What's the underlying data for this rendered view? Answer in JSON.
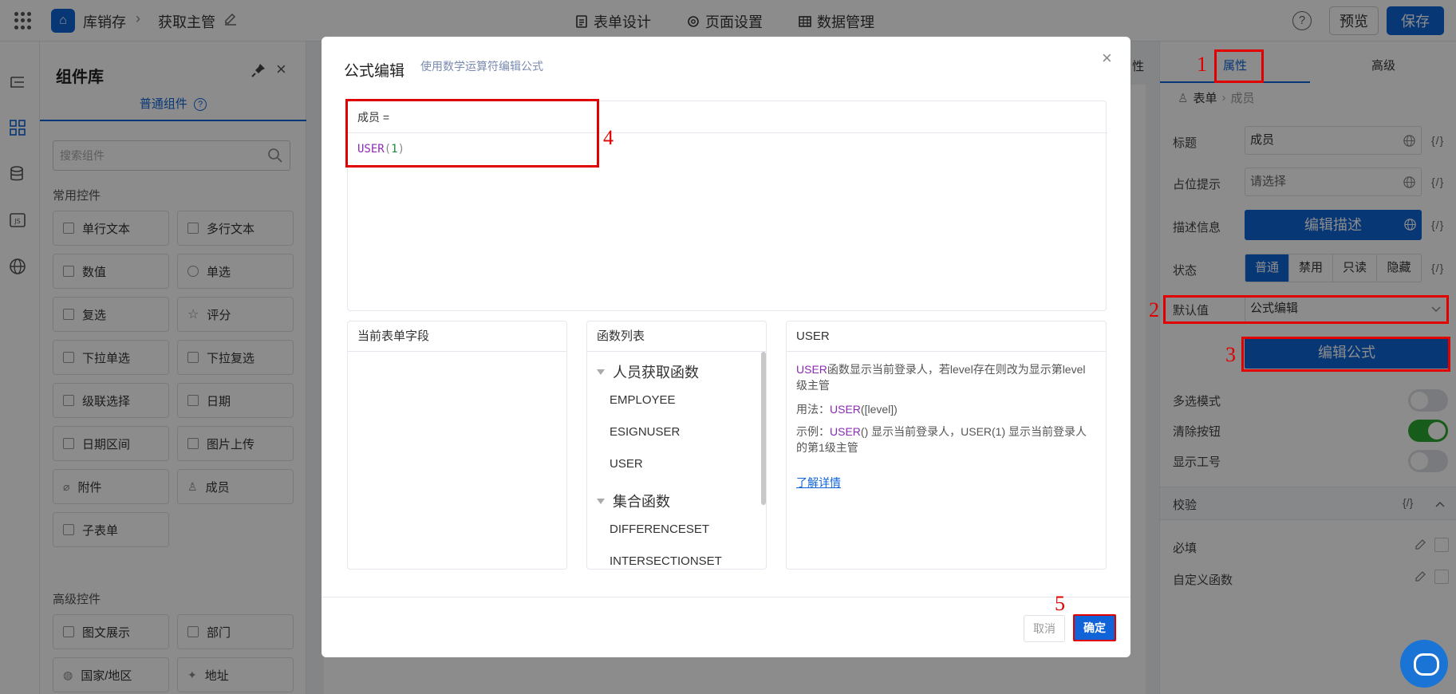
{
  "header": {
    "app_name": "库销存",
    "page_name": "获取主管",
    "nav": [
      "表单设计",
      "页面设置",
      "数据管理"
    ],
    "help": "?",
    "preview": "预览",
    "save": "保存"
  },
  "components": {
    "title": "组件库",
    "close": "×",
    "tab": "普通组件",
    "search_placeholder": "搜索组件",
    "common_title": "常用控件",
    "common": [
      "单行文本",
      "多行文本",
      "数值",
      "单选",
      "复选",
      "评分",
      "下拉单选",
      "下拉复选",
      "级联选择",
      "日期",
      "日期区间",
      "图片上传",
      "附件",
      "成员",
      "子表单"
    ],
    "advanced_title": "高级控件",
    "advanced": [
      "图文展示",
      "部门",
      "国家/地区",
      "地址"
    ]
  },
  "canvas": {
    "partial_tab": "性"
  },
  "properties": {
    "tabs": [
      "属性",
      "高级"
    ],
    "breadcrumb": [
      "表单",
      "成员"
    ],
    "title_label": "标题",
    "title_value": "成员",
    "placeholder_label": "占位提示",
    "placeholder_value": "请选择",
    "desc_label": "描述信息",
    "desc_button": "编辑描述",
    "fx": "{/}",
    "state_label": "状态",
    "states": [
      "普通",
      "禁用",
      "只读",
      "隐藏"
    ],
    "default_label": "默认值",
    "default_value": "公式编辑",
    "formula_button": "编辑公式",
    "multi_label": "多选模式",
    "clear_label": "清除按钮",
    "jobno_label": "显示工号",
    "validate_title": "校验",
    "required_label": "必填",
    "custom_fn_label": "自定义函数"
  },
  "modal": {
    "title": "公式编辑",
    "subtitle": "使用数学运算符编辑公式",
    "close": "×",
    "editor_head": "成员 =",
    "code_fn": "USER",
    "code_open": "(",
    "code_arg": "1",
    "code_close": ")",
    "fields_title": "当前表单字段",
    "functions_title": "函数列表",
    "group1": "人员获取函数",
    "group1_items": [
      "EMPLOYEE",
      "ESIGNUSER",
      "USER"
    ],
    "group2": "集合函数",
    "group2_items": [
      "DIFFERENCESET",
      "INTERSECTIONSET"
    ],
    "doc_title": "USER",
    "doc_fn": "USER",
    "doc_desc": "函数显示当前登录人，若level存在则改为显示第level级主管",
    "doc_usage_label": "用法：",
    "doc_usage_code": "USER",
    "doc_usage_args": "([level])",
    "doc_example_label": "示例：",
    "doc_example_code": "USER",
    "doc_example_text": "() 显示当前登录人，USER(1) 显示当前登录人的第1级主管",
    "doc_link": "了解详情",
    "cancel": "取消",
    "ok": "确定"
  },
  "annotations": [
    "1",
    "2",
    "3",
    "4",
    "5"
  ],
  "colors": {
    "primary": "#1064d8",
    "annotation": "#e00000",
    "fn_purple": "#8c2bb5",
    "toggle_on": "#2aa830"
  }
}
